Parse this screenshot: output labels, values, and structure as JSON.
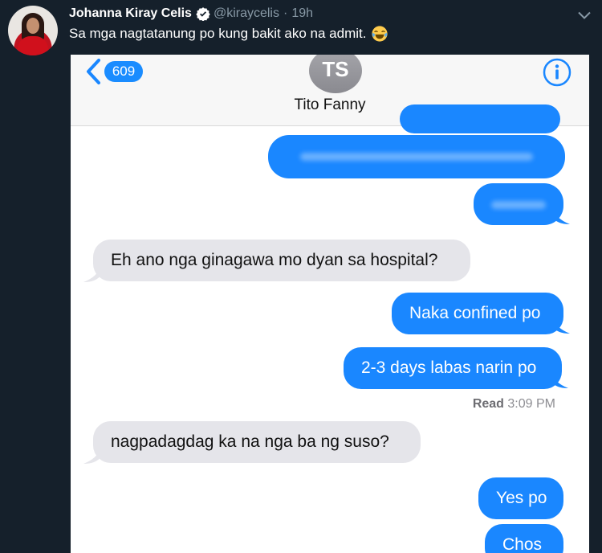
{
  "tweet": {
    "author_name": "Johanna Kiray Celis",
    "handle": "@kiraycelis",
    "separator": "·",
    "time": "19h",
    "text": "Sa mga nagtatanung po kung bakit ako na admit.",
    "emoji": "laughing-with-tears-emoji"
  },
  "imessage": {
    "back_count": "609",
    "contact_initials": "TS",
    "contact_name": "Tito Fanny",
    "messages": [
      {
        "from": "me",
        "text": "",
        "redacted": true
      },
      {
        "from": "me",
        "text": "",
        "redacted": true
      },
      {
        "from": "me",
        "text": "",
        "redacted": true
      },
      {
        "from": "them",
        "text": "Eh ano nga ginagawa mo dyan sa hospital?"
      },
      {
        "from": "me",
        "text": "Naka confined po"
      },
      {
        "from": "me",
        "text": "2-3 days labas narin po"
      },
      {
        "from": "them",
        "text": "nagpadagdag ka na nga ba ng suso?"
      },
      {
        "from": "me",
        "text": "Yes po"
      },
      {
        "from": "me",
        "text": "Chos"
      }
    ],
    "read_label": "Read",
    "read_time": "3:09 PM"
  },
  "colors": {
    "twitter_bg": "#15202b",
    "imessage_blue": "#1a87ff",
    "received_gray": "#e5e5ea"
  }
}
